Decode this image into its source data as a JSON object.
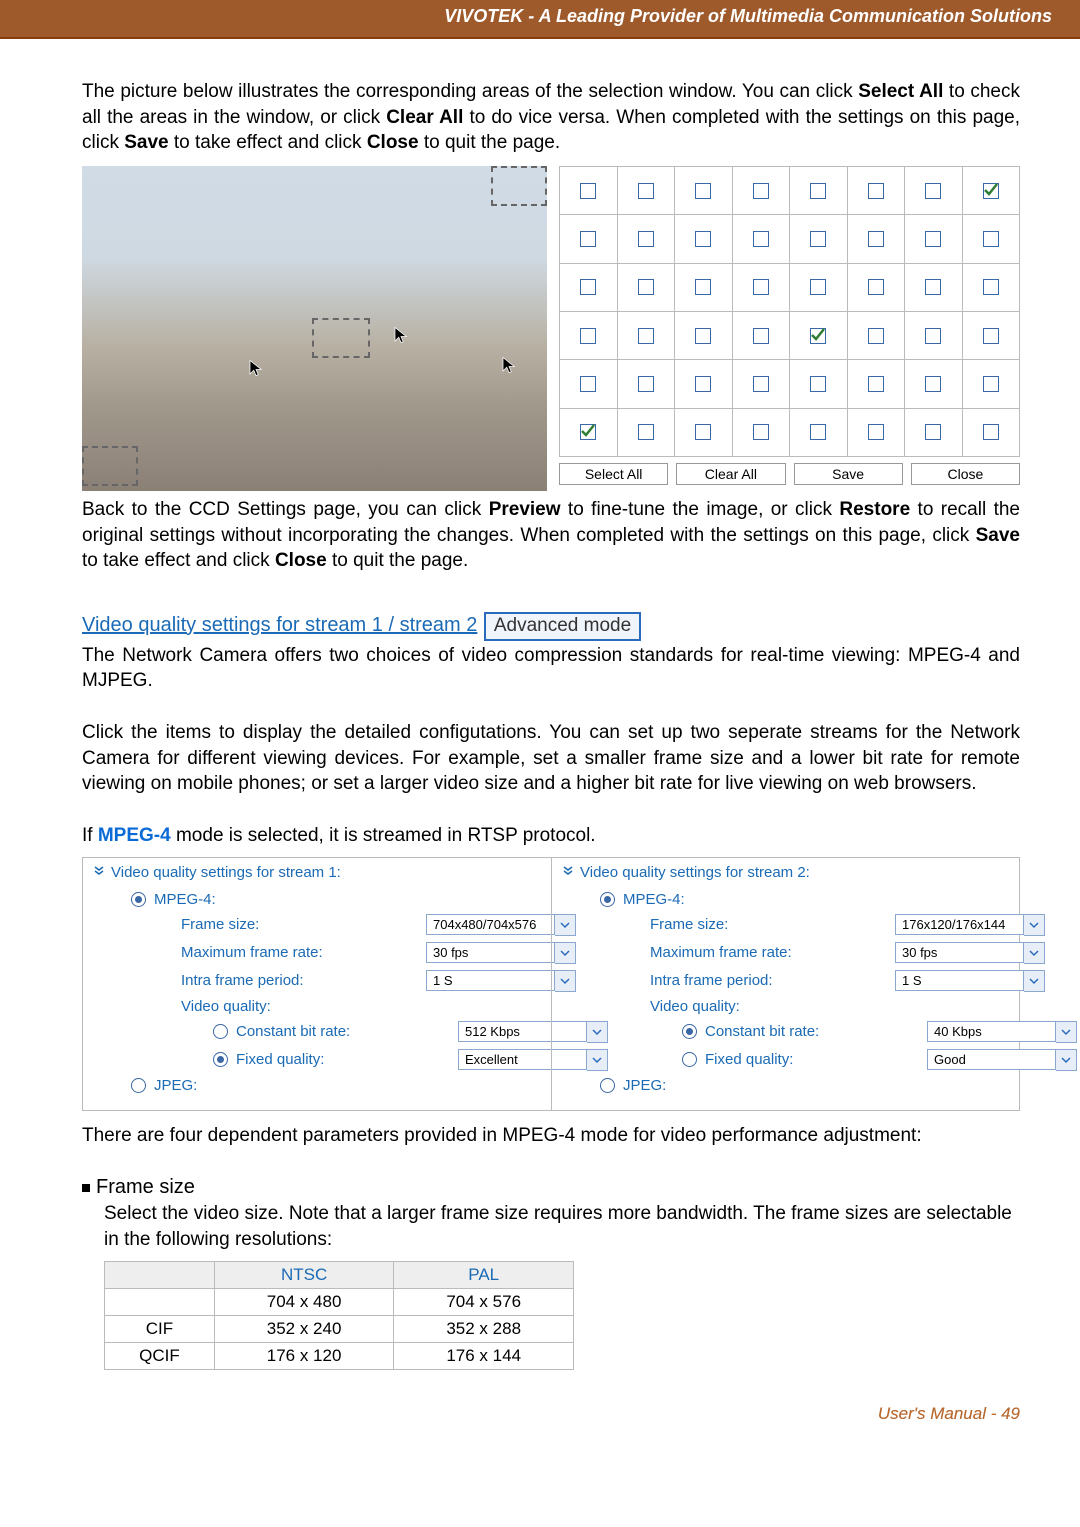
{
  "header": "VIVOTEK - A Leading Provider of Multimedia Communication Solutions",
  "p1a": "The picture below illustrates the corresponding areas of the selection window. You can click ",
  "p1_selectall": "Select All",
  "p1b": " to check all the areas in the window, or click ",
  "p1_clearall": "Clear All",
  "p1c": " to do vice versa. When completed with the settings on this page, click ",
  "p1_save": "Save",
  "p1d": " to take effect and click ",
  "p1_close": "Close",
  "p1e": " to quit the page.",
  "grid": {
    "rows": 6,
    "cols": 8,
    "checked": [
      [
        0,
        7
      ],
      [
        3,
        4
      ],
      [
        5,
        0
      ]
    ],
    "buttons": {
      "select_all": "Select All",
      "clear_all": "Clear All",
      "save": "Save",
      "close": "Close"
    }
  },
  "p2a": "Back to the CCD Settings page, you can click ",
  "p2_preview": "Preview",
  "p2b": " to fine-tune the image, or click ",
  "p2_restore": "Restore",
  "p2c": " to recall the original settings without incorporating the changes. When completed with the settings on this page, click ",
  "p2_save": "Save",
  "p2d": " to take effect and click ",
  "p2_close": "Close",
  "p2e": " to quit the page.",
  "vqs_link": "Video quality settings for stream 1 / stream 2",
  "adv_mode": "Advanced mode",
  "p3": "The Network Camera offers two choices of video compression standards for real-time viewing: MPEG-4 and MJPEG.",
  "p4": "Click the items to display the detailed configutations. You can set up two seperate streams for the Network Camera for different viewing devices. For example, set a smaller frame size and a lower bit rate for remote viewing on mobile phones; or set a larger video size and a higher bit rate for live viewing on web browsers.",
  "p5a": "If ",
  "p5_key": "MPEG-4",
  "p5b": " mode is selected, it is streamed in RTSP protocol.",
  "panel1": {
    "title": "Video quality settings for stream 1:",
    "mpeg4_label": "MPEG-4:",
    "mpeg4_checked": true,
    "frame_size_label": "Frame size:",
    "frame_size_value": "704x480/704x576",
    "max_fr_label": "Maximum frame rate:",
    "max_fr_value": "30 fps",
    "intra_label": "Intra frame period:",
    "intra_value": "1 S",
    "vq_label": "Video quality:",
    "cbr_label": "Constant bit rate:",
    "cbr_checked": false,
    "cbr_value": "512 Kbps",
    "fq_label": "Fixed quality:",
    "fq_checked": true,
    "fq_value": "Excellent",
    "jpeg_label": "JPEG:",
    "jpeg_checked": false
  },
  "panel2": {
    "title": "Video quality settings for stream 2:",
    "mpeg4_label": "MPEG-4:",
    "mpeg4_checked": true,
    "frame_size_label": "Frame size:",
    "frame_size_value": "176x120/176x144",
    "max_fr_label": "Maximum frame rate:",
    "max_fr_value": "30 fps",
    "intra_label": "Intra frame period:",
    "intra_value": "1 S",
    "vq_label": "Video quality:",
    "cbr_label": "Constant bit rate:",
    "cbr_checked": true,
    "cbr_value": "40 Kbps",
    "fq_label": "Fixed quality:",
    "fq_checked": false,
    "fq_value": "Good",
    "jpeg_label": "JPEG:",
    "jpeg_checked": false
  },
  "p6": "There are four dependent parameters provided  in MPEG-4 mode for video performance adjustment:",
  "bullet_title": "Frame size",
  "bullet_body": "Select the video size. Note that a larger frame size requires more bandwidth. The frame sizes are selectable in the following resolutions:",
  "table": {
    "headers": [
      "",
      "NTSC",
      "PAL"
    ],
    "rows": [
      [
        "",
        "704 x 480",
        "704 x 576"
      ],
      [
        "CIF",
        "352 x 240",
        "352 x 288"
      ],
      [
        "QCIF",
        "176 x 120",
        "176 x 144"
      ]
    ]
  },
  "footer": "User's Manual - 49"
}
